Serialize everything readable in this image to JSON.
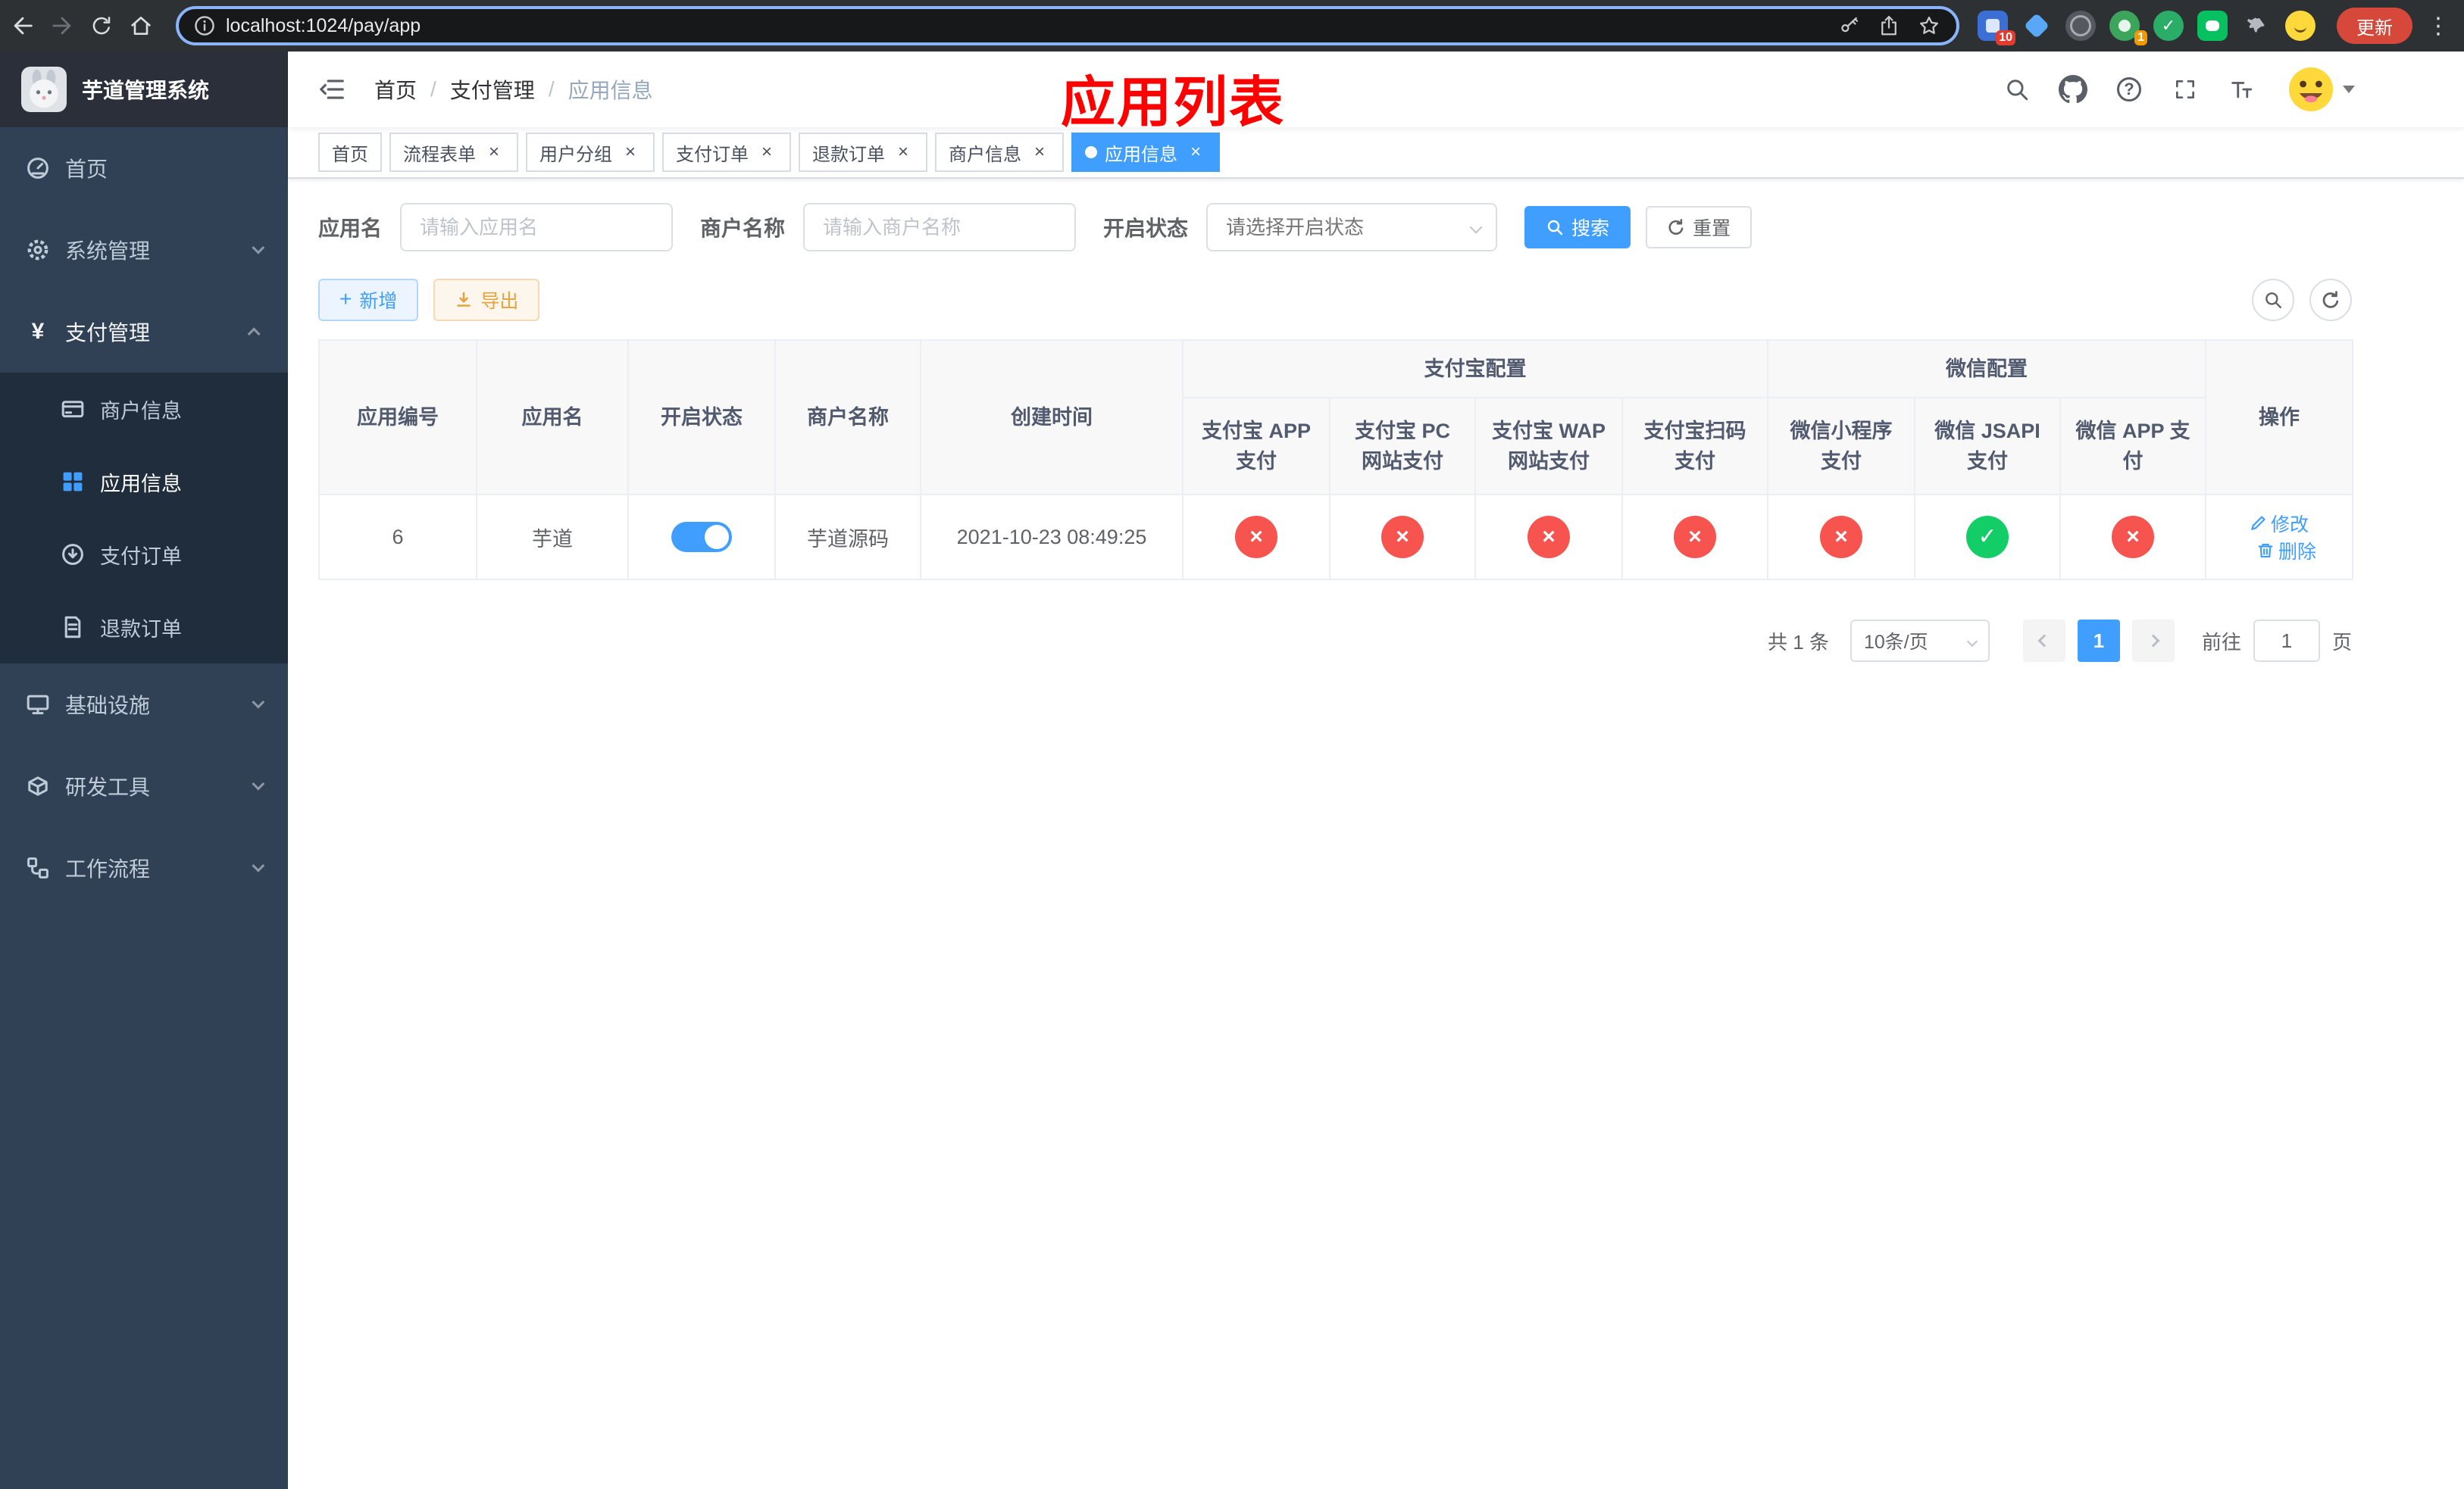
{
  "colors": {
    "accent": "#409eff",
    "success": "#13ce66",
    "danger": "#f7534f",
    "warning": "#e6a23c",
    "sidebar-bg": "#304156",
    "sidebar-sub-bg": "#1f2d3d",
    "annotation": "#fe0000"
  },
  "browser": {
    "url": "localhost:1024/pay/app",
    "update_label": "更新",
    "ext_badge_1": "10",
    "ext_badge_2": "1"
  },
  "sidebar": {
    "logo_title": "芋道管理系统",
    "items": [
      {
        "label": "首页",
        "icon": "dashboard-icon"
      },
      {
        "label": "系统管理",
        "icon": "gear-icon"
      },
      {
        "label": "支付管理",
        "icon": "yen-icon"
      },
      {
        "label": "商户信息",
        "icon": "merchant-card-icon"
      },
      {
        "label": "应用信息",
        "icon": "app-grid-icon"
      },
      {
        "label": "支付订单",
        "icon": "pay-order-icon"
      },
      {
        "label": "退款订单",
        "icon": "refund-doc-icon"
      },
      {
        "label": "基础设施",
        "icon": "monitor-icon"
      },
      {
        "label": "研发工具",
        "icon": "toolbox-icon"
      },
      {
        "label": "工作流程",
        "icon": "workflow-icon"
      }
    ]
  },
  "header": {
    "breadcrumb": [
      "首页",
      "支付管理",
      "应用信息"
    ],
    "annotation": "应用列表"
  },
  "tabs": {
    "items": [
      {
        "label": "首页"
      },
      {
        "label": "流程表单"
      },
      {
        "label": "用户分组"
      },
      {
        "label": "支付订单"
      },
      {
        "label": "退款订单"
      },
      {
        "label": "商户信息"
      },
      {
        "label": "应用信息"
      }
    ]
  },
  "filters": {
    "app_name_label": "应用名",
    "app_name_placeholder": "请输入应用名",
    "merchant_label": "商户名称",
    "merchant_placeholder": "请输入商户名称",
    "status_label": "开启状态",
    "status_placeholder": "请选择开启状态",
    "search_label": "搜索",
    "reset_label": "重置"
  },
  "toolbar": {
    "add_label": "新增",
    "export_label": "导出"
  },
  "table": {
    "groups": {
      "alipay": "支付宝配置",
      "wechat": "微信配置"
    },
    "columns": [
      "应用编号",
      "应用名",
      "开启状态",
      "商户名称",
      "创建时间",
      "支付宝 APP 支付",
      "支付宝 PC 网站支付",
      "支付宝 WAP 网站支付",
      "支付宝扫码支付",
      "微信小程序支付",
      "微信 JSAPI 支付",
      "微信 APP 支付",
      "操作"
    ],
    "rows": [
      {
        "id": "6",
        "name": "芋道",
        "enabled": true,
        "merchant": "芋道源码",
        "created": "2021-10-23 08:49:25",
        "alipay_app": false,
        "alipay_pc": false,
        "alipay_wap": false,
        "alipay_qr": false,
        "wx_mini": false,
        "wx_jsapi": true,
        "wx_app": false,
        "edit_label": "修改",
        "delete_label": "删除"
      }
    ]
  },
  "pagination": {
    "total_text": "共 1 条",
    "page_size": "10条/页",
    "current_page": "1",
    "goto_prefix": "前往",
    "goto_value": "1",
    "goto_suffix": "页"
  }
}
